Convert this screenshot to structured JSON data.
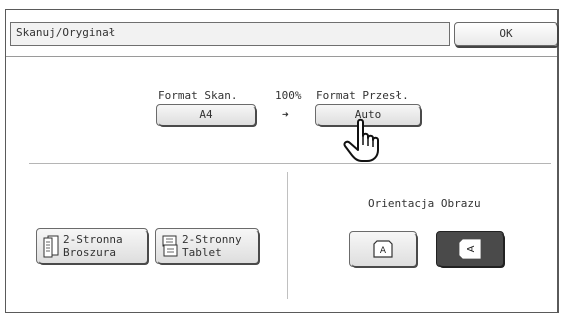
{
  "title": "Skanuj/Oryginał",
  "ok_label": "OK",
  "scan": {
    "label": "Format Skan.",
    "value": "A4",
    "ratio": "100%",
    "arrow": "➜"
  },
  "send": {
    "label": "Format Przesł.",
    "value": "Auto"
  },
  "booklet": {
    "line1": "2-Stronna",
    "line2": "Broszura"
  },
  "tablet": {
    "line1": "2-Stronny",
    "line2": "Tablet"
  },
  "orientation": {
    "label": "Orientacja Obrazu",
    "portrait_glyph": "A",
    "landscape_glyph": "A",
    "selected": "landscape"
  },
  "icons": {
    "booklet": "booklet-icon",
    "tablet": "tablet-icon",
    "pointer": "hand-pointer-icon"
  }
}
